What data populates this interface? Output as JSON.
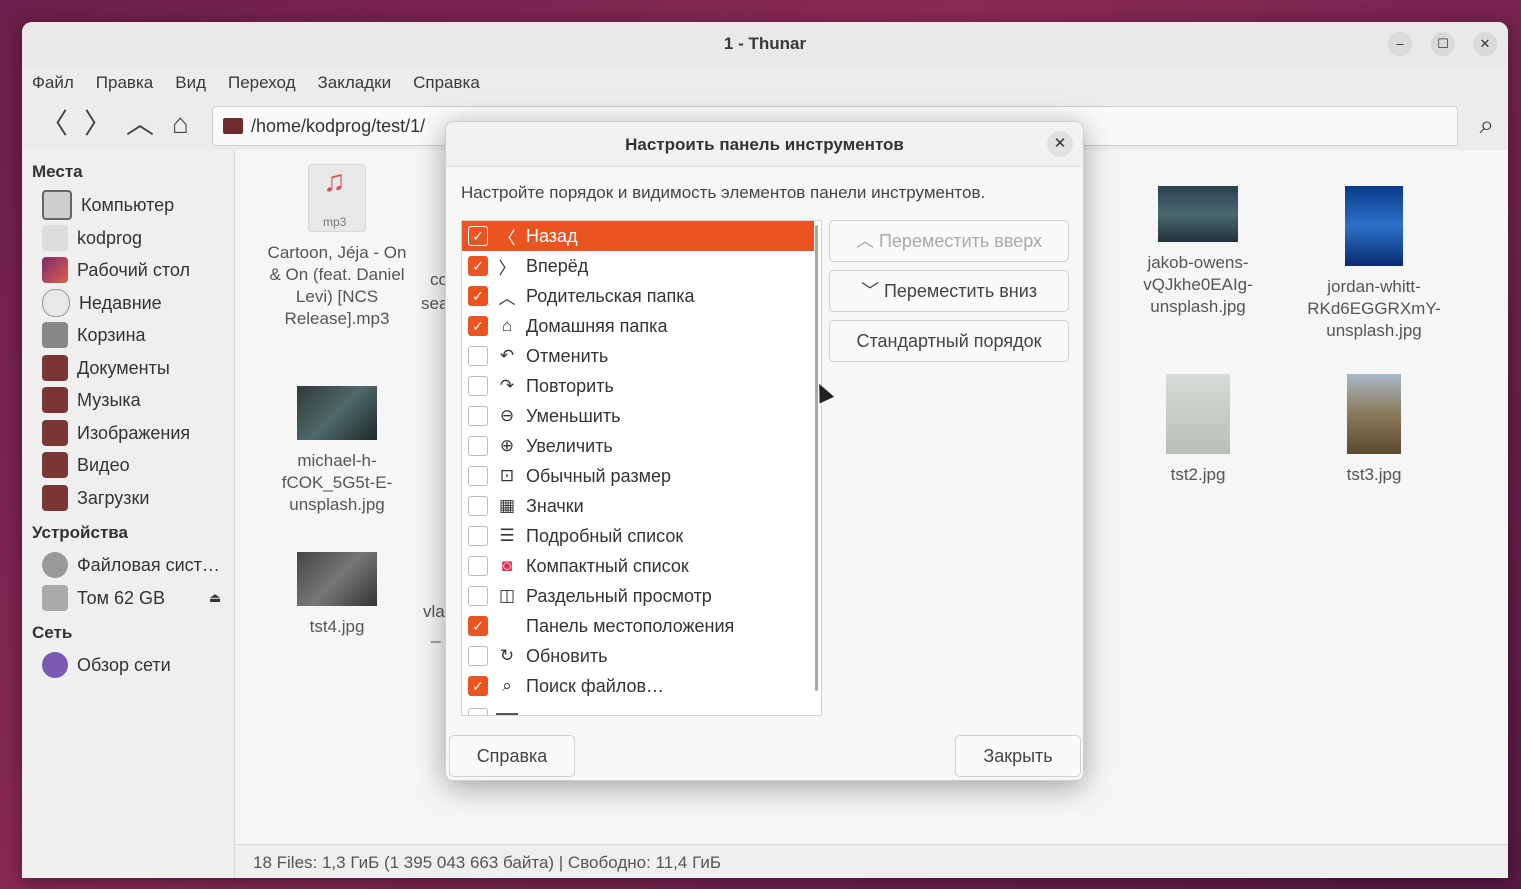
{
  "window": {
    "title": "1 - Thunar",
    "minimize": "–",
    "maximize": "☐",
    "close": "✕"
  },
  "menu": [
    "Файл",
    "Правка",
    "Вид",
    "Переход",
    "Закладки",
    "Справка"
  ],
  "toolbar": {
    "path": "/home/kodprog/test/1/"
  },
  "sidebar": {
    "places_title": "Места",
    "places": [
      "Компьютер",
      "kodprog",
      "Рабочий стол",
      "Недавние",
      "Корзина",
      "Документы",
      "Музыка",
      "Изображения",
      "Видео",
      "Загрузки"
    ],
    "devices_title": "Устройства",
    "devices": [
      "Файловая сист…",
      "Том 62 GB"
    ],
    "network_title": "Сеть",
    "network": [
      "Обзор сети"
    ]
  },
  "files": [
    {
      "name": "Cartoon, Jéja - On & On (feat. Daniel Levi) [NCS Release].mp3",
      "l1": "Cartoon, Jéja - On",
      "l2": "& On (feat. Daniel",
      "l3": "Levi) [NCS",
      "l4": "Release].mp3",
      "badge": "mp3"
    },
    {
      "l1": "michael-h-",
      "l2": "fCOK_5G5t-E-",
      "l3": "unsplash.jpg"
    },
    {
      "l1": "tst4.jpg"
    },
    {
      "l1": "jakob-owens-",
      "l2": "vQJkhe0EAIg-",
      "l3": "unsplash.jpg"
    },
    {
      "l1": "jordan-whitt-",
      "l2": "RKd6EGGRXmY-",
      "l3": "unsplash.jpg"
    },
    {
      "l1": "tst2.jpg"
    },
    {
      "l1": "tst3.jpg"
    }
  ],
  "partial": {
    "a": "co",
    "b": "sea",
    "c": "vla",
    "d": "_"
  },
  "status": "18 Files: 1,3 ГиБ (1 395 043 663 байта)  |  Свободно: 11,4 ГиБ",
  "dialog": {
    "title": "Настроить панель инструментов",
    "close": "✕",
    "description": "Настройте порядок и видимость элементов панели инструментов.",
    "items": [
      {
        "label": "Назад",
        "checked": true,
        "icon": "〈"
      },
      {
        "label": "Вперёд",
        "checked": true,
        "icon": "〉"
      },
      {
        "label": "Родительская папка",
        "checked": true,
        "icon": "︿"
      },
      {
        "label": "Домашняя папка",
        "checked": true,
        "icon": "⌂"
      },
      {
        "label": "Отменить",
        "checked": false,
        "icon": "↶"
      },
      {
        "label": "Повторить",
        "checked": false,
        "icon": "↷"
      },
      {
        "label": "Уменьшить",
        "checked": false,
        "icon": "⊖"
      },
      {
        "label": "Увеличить",
        "checked": false,
        "icon": "⊕"
      },
      {
        "label": "Обычный размер",
        "checked": false,
        "icon": "⊡"
      },
      {
        "label": "Значки",
        "checked": false,
        "icon": "▦"
      },
      {
        "label": "Подробный список",
        "checked": false,
        "icon": "☰"
      },
      {
        "label": "Компактный список",
        "checked": false,
        "icon": "◙"
      },
      {
        "label": "Раздельный просмотр",
        "checked": false,
        "icon": "◫"
      },
      {
        "label": "Панель местоположения",
        "checked": true,
        "icon": ""
      },
      {
        "label": "Обновить",
        "checked": false,
        "icon": "↻"
      },
      {
        "label": "Поиск файлов…",
        "checked": true,
        "icon": "⌕"
      }
    ],
    "btn_up": "︿ Переместить вверх",
    "btn_down": "﹀ Переместить вниз",
    "btn_default": "Стандартный порядок",
    "btn_help": "Справка",
    "btn_close": "Закрыть"
  }
}
